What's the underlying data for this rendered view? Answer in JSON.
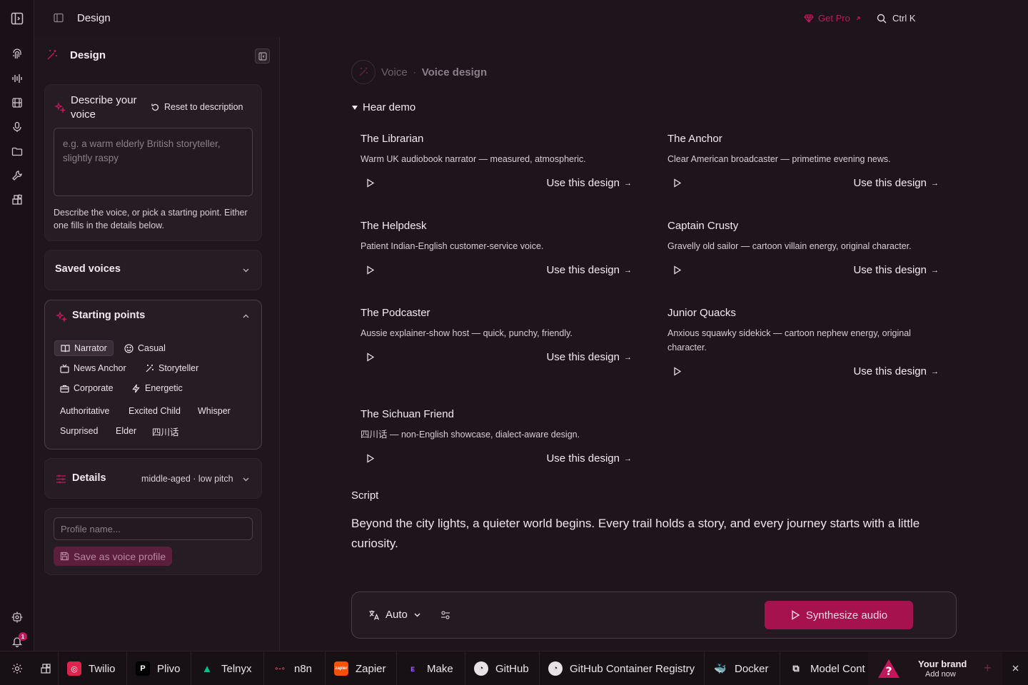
{
  "topbar": {
    "title": "Design",
    "get_pro": "Get Pro",
    "search_shortcut": "Ctrl K"
  },
  "sidebar": {
    "title": "Design",
    "describe": {
      "title": "Describe your voice",
      "reset_label": "Reset to description",
      "placeholder": "e.g. a warm elderly British storyteller, slightly raspy",
      "helper": "Describe the voice, or pick a starting point. Either one fills in the details below."
    },
    "saved_voices": {
      "label": "Saved voices"
    },
    "starting_points": {
      "title": "Starting points",
      "chips": [
        {
          "label": "Narrator",
          "icon": "book-icon",
          "active": true
        },
        {
          "label": "Casual",
          "icon": "smile-icon",
          "active": false
        },
        {
          "label": "News Anchor",
          "icon": "tv-icon",
          "active": false
        },
        {
          "label": "Storyteller",
          "icon": "wand-icon",
          "active": false
        },
        {
          "label": "Corporate",
          "icon": "briefcase-icon",
          "active": false
        },
        {
          "label": "Energetic",
          "icon": "zap-icon",
          "active": false
        },
        {
          "label": "Authoritative",
          "icon": "",
          "active": false
        },
        {
          "label": "Excited Child",
          "icon": "",
          "active": false
        },
        {
          "label": "Whisper",
          "icon": "",
          "active": false
        },
        {
          "label": "Surprised",
          "icon": "",
          "active": false
        },
        {
          "label": "Elder",
          "icon": "",
          "active": false
        },
        {
          "label": "四川话",
          "icon": "",
          "active": false
        }
      ]
    },
    "details": {
      "label": "Details",
      "summary": "middle-aged · low pitch"
    },
    "profile": {
      "placeholder": "Profile name...",
      "save_label": "Save as voice profile"
    }
  },
  "main": {
    "breadcrumb": {
      "parent": "Voice",
      "separator": "·",
      "current": "Voice design"
    },
    "hear_demo": "Hear demo",
    "use_label": "Use this design",
    "use_arrow": "→",
    "demos": [
      {
        "name": "The Librarian",
        "desc": "Warm UK audiobook narrator — measured, atmospheric."
      },
      {
        "name": "The Anchor",
        "desc": "Clear American broadcaster — primetime evening news."
      },
      {
        "name": "The Helpdesk",
        "desc": "Patient Indian-English customer-service voice."
      },
      {
        "name": "Captain Crusty",
        "desc": "Gravelly old sailor — cartoon villain energy, original character."
      },
      {
        "name": "The Podcaster",
        "desc": "Aussie explainer-show host — quick, punchy, friendly."
      },
      {
        "name": "Junior Quacks",
        "desc": "Anxious squawky sidekick — cartoon nephew energy, original character."
      },
      {
        "name": "The Sichuan Friend",
        "desc": "四川话 — non-English showcase, dialect-aware design."
      }
    ],
    "script_label": "Script",
    "script_text": "Beyond the city lights, a quieter world begins. Every trail holds a story, and every journey starts with a little curiosity.",
    "language": "Auto",
    "synthesize_label": "Synthesize audio"
  },
  "rail": {
    "notification_count": "1"
  },
  "taskbar": {
    "items": [
      "Twilio",
      "Plivo",
      "Telnyx",
      "n8n",
      "Zapier",
      "Make",
      "GitHub",
      "GitHub Container Registry",
      "Docker",
      "Model Cont"
    ],
    "brand_title": "Your brand",
    "brand_sub": "Add now"
  },
  "colors": {
    "accent": "#a5124e",
    "accent_text": "#c2185b",
    "background": "#1e141c"
  }
}
